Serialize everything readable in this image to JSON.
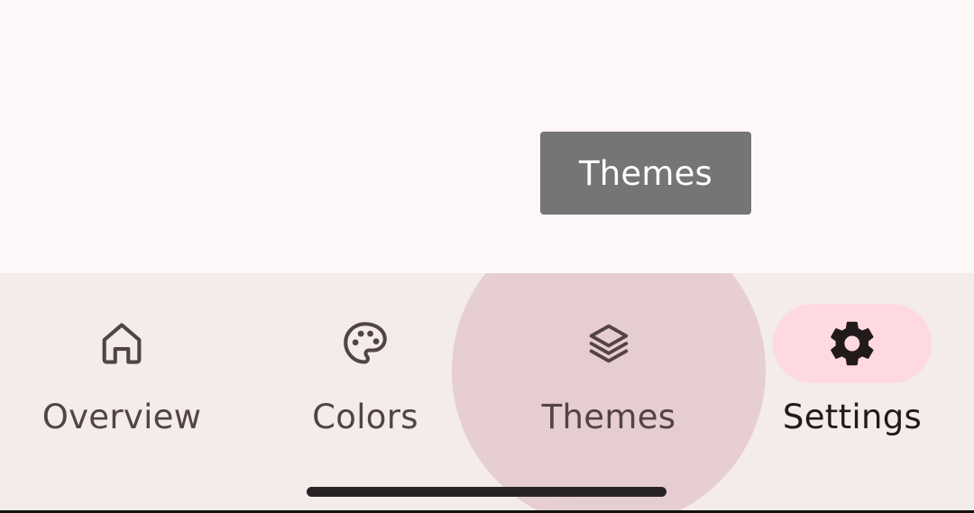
{
  "tooltip": {
    "text": "Themes"
  },
  "navigation": {
    "items": [
      {
        "label": "Overview",
        "icon": "home-icon",
        "selected": false
      },
      {
        "label": "Colors",
        "icon": "palette-icon",
        "selected": false
      },
      {
        "label": "Themes",
        "icon": "layers-icon",
        "selected": false,
        "pressed": true
      },
      {
        "label": "Settings",
        "icon": "gear-icon",
        "selected": true
      }
    ]
  },
  "colors": {
    "background": "#fdf8f7",
    "nav_background": "#f4ebeb",
    "active_indicator": "#ffd9e0",
    "ripple": "#e6cdd1",
    "tooltip_background": "#757575",
    "icon": "#524346",
    "active_icon": "#22191b"
  }
}
